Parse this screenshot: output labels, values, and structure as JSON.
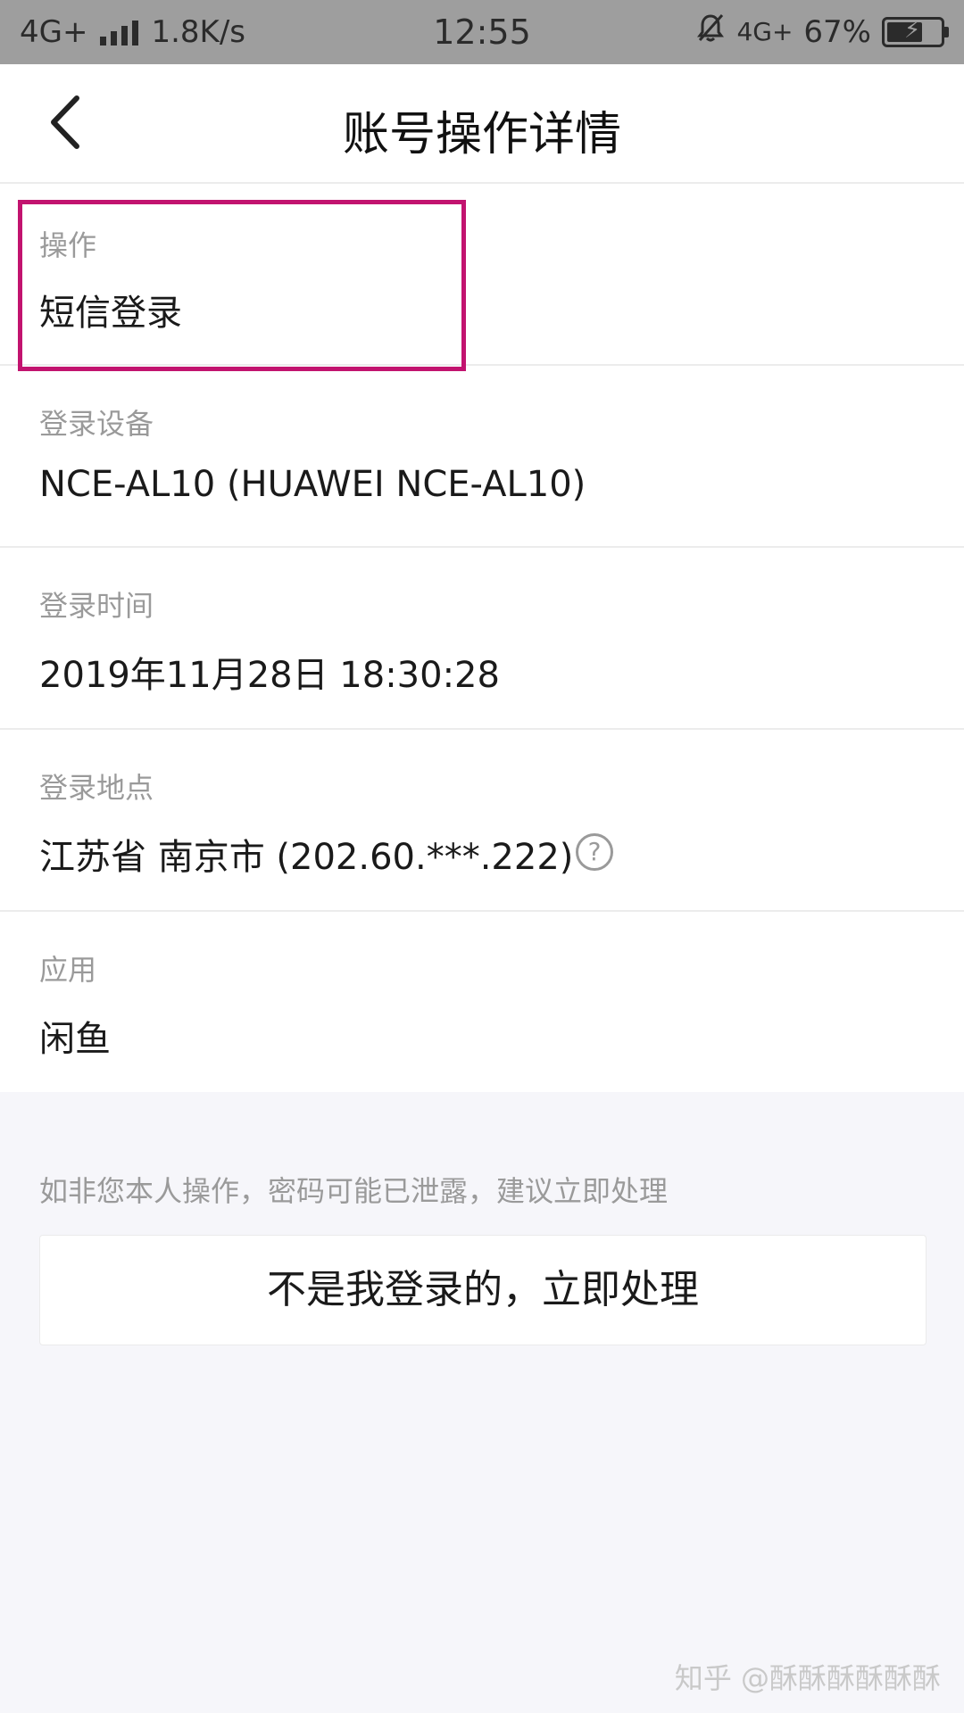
{
  "status_bar": {
    "network_left": "4G+",
    "speed": "1.8K/s",
    "time": "12:55",
    "network_right": "4G+",
    "battery_percent_text": "67%",
    "battery_level": 0.67
  },
  "header": {
    "back_icon": "chevron-left-icon",
    "title": "账号操作详情"
  },
  "details": [
    {
      "label": "操作",
      "value": "短信登录"
    },
    {
      "label": "登录设备",
      "value": "NCE-AL10 (HUAWEI NCE-AL10)"
    },
    {
      "label": "登录时间",
      "value": "2019年11月28日 18:30:28"
    },
    {
      "label": "登录地点",
      "value": "江苏省 南京市 (202.60.***.222)"
    },
    {
      "label": "应用",
      "value": "闲鱼"
    }
  ],
  "help_icon_text": "?",
  "hint": "如非您本人操作，密码可能已泄露，建议立即处理",
  "action_button": "不是我登录的，立即处理",
  "watermark": "知乎 @酥酥酥酥酥酥",
  "colors": {
    "highlight_border": "#c2136f",
    "status_bar_bg": "#9e9e9e",
    "page_bg": "#f6f6fa"
  }
}
